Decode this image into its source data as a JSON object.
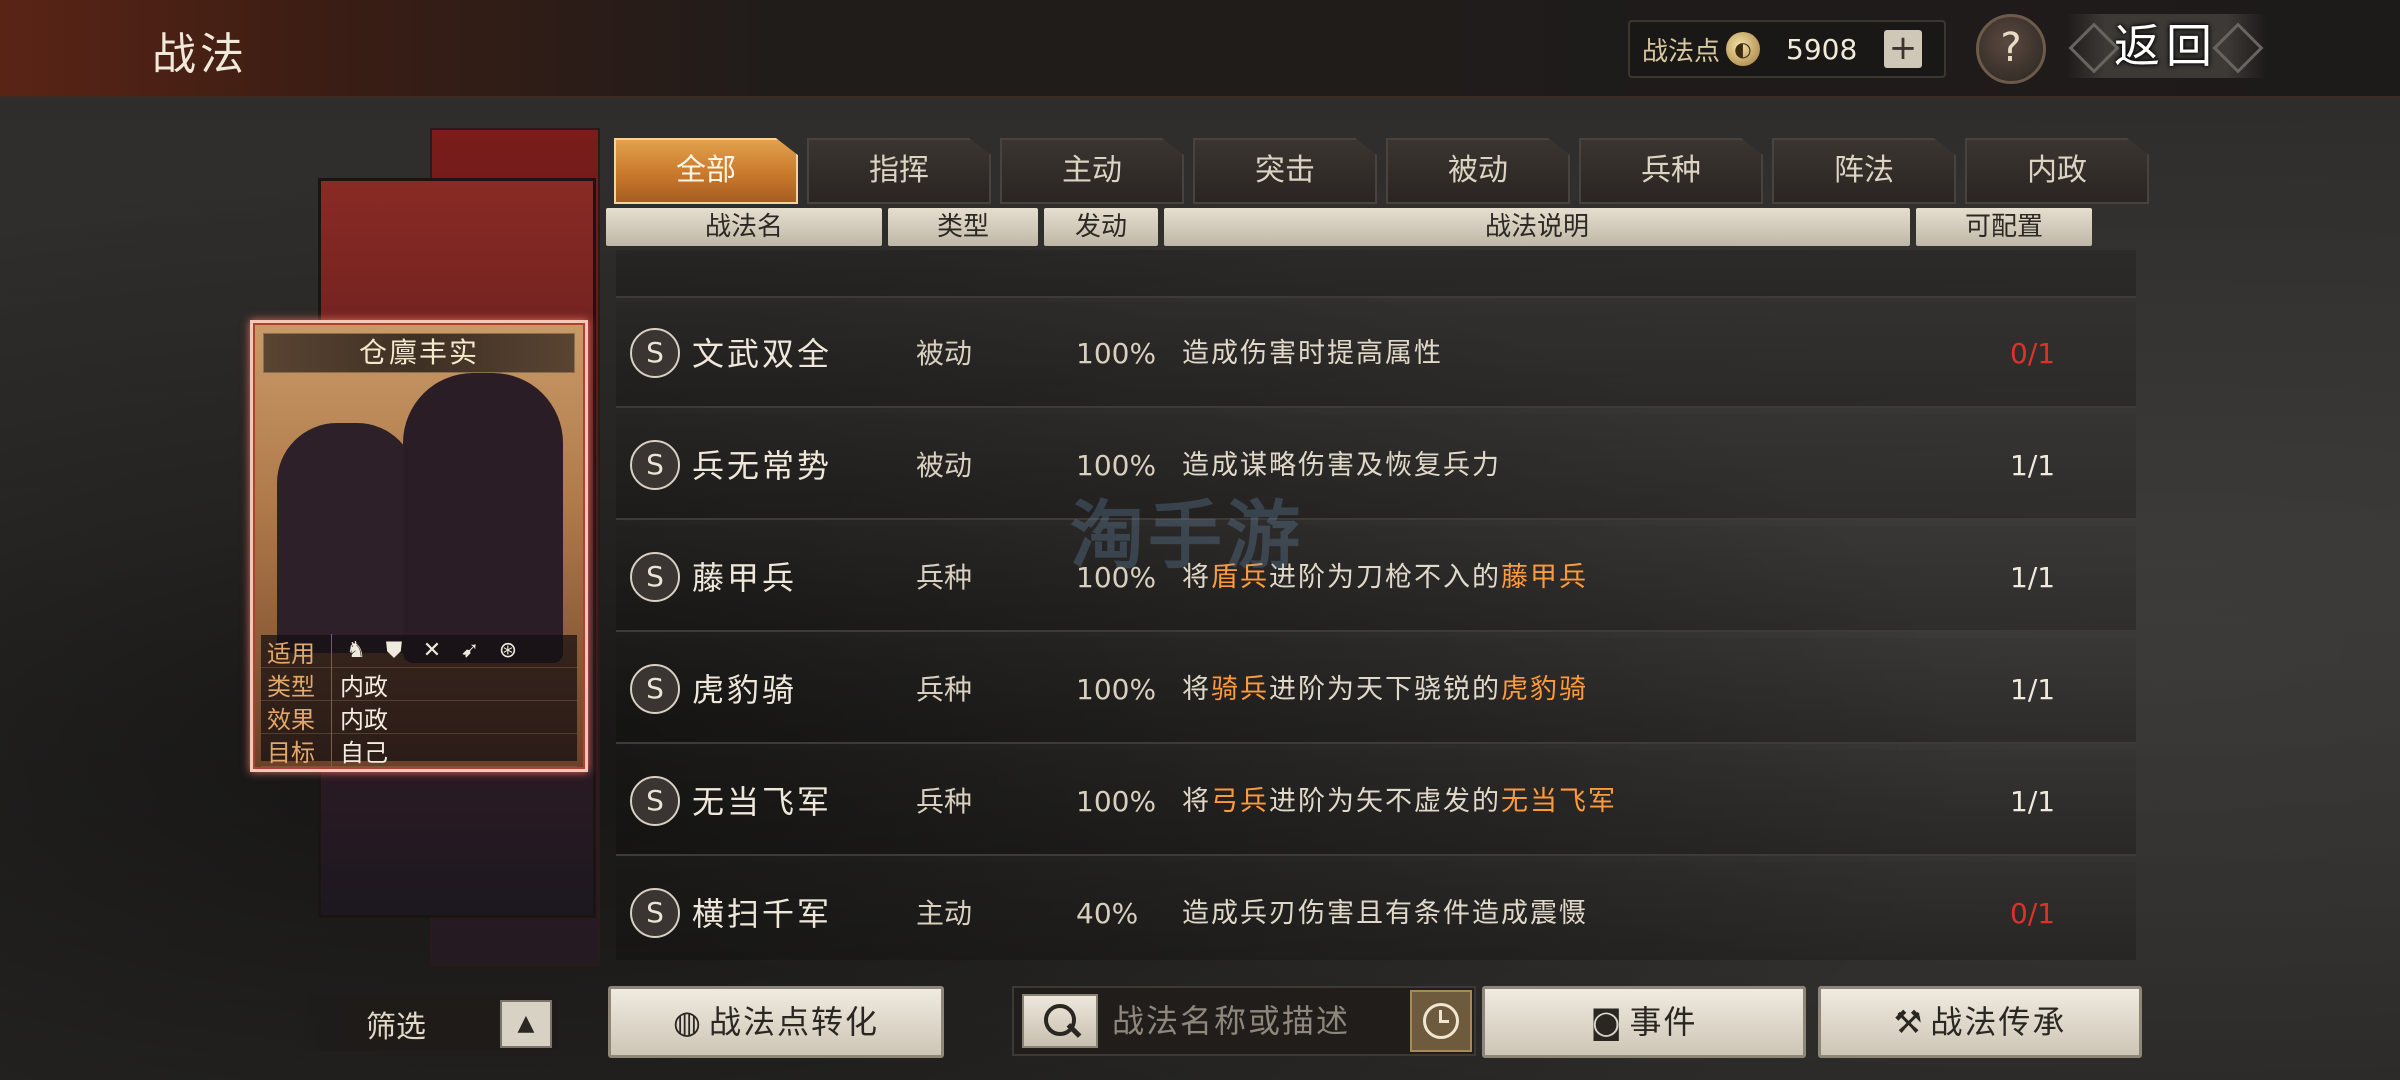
{
  "header": {
    "title": "战法",
    "points_label": "战法点",
    "points_value": "5908",
    "plus": "+",
    "help": "?",
    "back_label": "返回"
  },
  "card": {
    "title": "仓廪丰实",
    "rows": [
      {
        "key": "适用",
        "value": ""
      },
      {
        "key": "类型",
        "value": "内政"
      },
      {
        "key": "效果",
        "value": "内政"
      },
      {
        "key": "目标",
        "value": "自己"
      }
    ],
    "troop_icons": [
      "cavalry-icon",
      "shield-icon",
      "bow-icon",
      "spear-icon",
      "wheel-icon"
    ]
  },
  "tabs": [
    "全部",
    "指挥",
    "主动",
    "突击",
    "被动",
    "兵种",
    "阵法",
    "内政"
  ],
  "active_tab": "全部",
  "columns": [
    "战法名",
    "类型",
    "发动",
    "战法说明",
    "可配置"
  ],
  "rows": [
    {
      "badge": "S",
      "name": "文武双全",
      "type": "被动",
      "rate": "100%",
      "desc_parts": [
        "造成伤害时提高属性"
      ],
      "count": "0/1",
      "count_color": "red"
    },
    {
      "badge": "S",
      "name": "兵无常势",
      "type": "被动",
      "rate": "100%",
      "desc_parts": [
        "造成谋略伤害及恢复兵力"
      ],
      "count": "1/1",
      "count_color": "white"
    },
    {
      "badge": "S",
      "name": "藤甲兵",
      "type": "兵种",
      "rate": "100%",
      "desc_parts": [
        "将",
        "盾兵",
        "进阶为刀枪不入的",
        "藤甲兵"
      ],
      "count": "1/1",
      "count_color": "white"
    },
    {
      "badge": "S",
      "name": "虎豹骑",
      "type": "兵种",
      "rate": "100%",
      "desc_parts": [
        "将",
        "骑兵",
        "进阶为天下骁锐的",
        "虎豹骑"
      ],
      "count": "1/1",
      "count_color": "white"
    },
    {
      "badge": "S",
      "name": "无当飞军",
      "type": "兵种",
      "rate": "100%",
      "desc_parts": [
        "将",
        "弓兵",
        "进阶为矢不虚发的",
        "无当飞军"
      ],
      "count": "1/1",
      "count_color": "white"
    },
    {
      "badge": "S",
      "name": "横扫千军",
      "type": "主动",
      "rate": "40%",
      "desc_parts": [
        "造成兵刃伤害且有条件造成震慑"
      ],
      "count": "0/1",
      "count_color": "red"
    }
  ],
  "watermark": "淘手游",
  "bottom": {
    "filter_label": "筛选",
    "filter_toggle": "▲",
    "convert_button": "战法点转化",
    "search_placeholder": "战法名称或描述",
    "event_button": "事件",
    "inherit_button": "战法传承"
  },
  "colors": {
    "accent": "#c9792c",
    "highlight_text": "#ff9a3a",
    "count_red": "#e0302a",
    "card_border": "#f2c8b8"
  }
}
